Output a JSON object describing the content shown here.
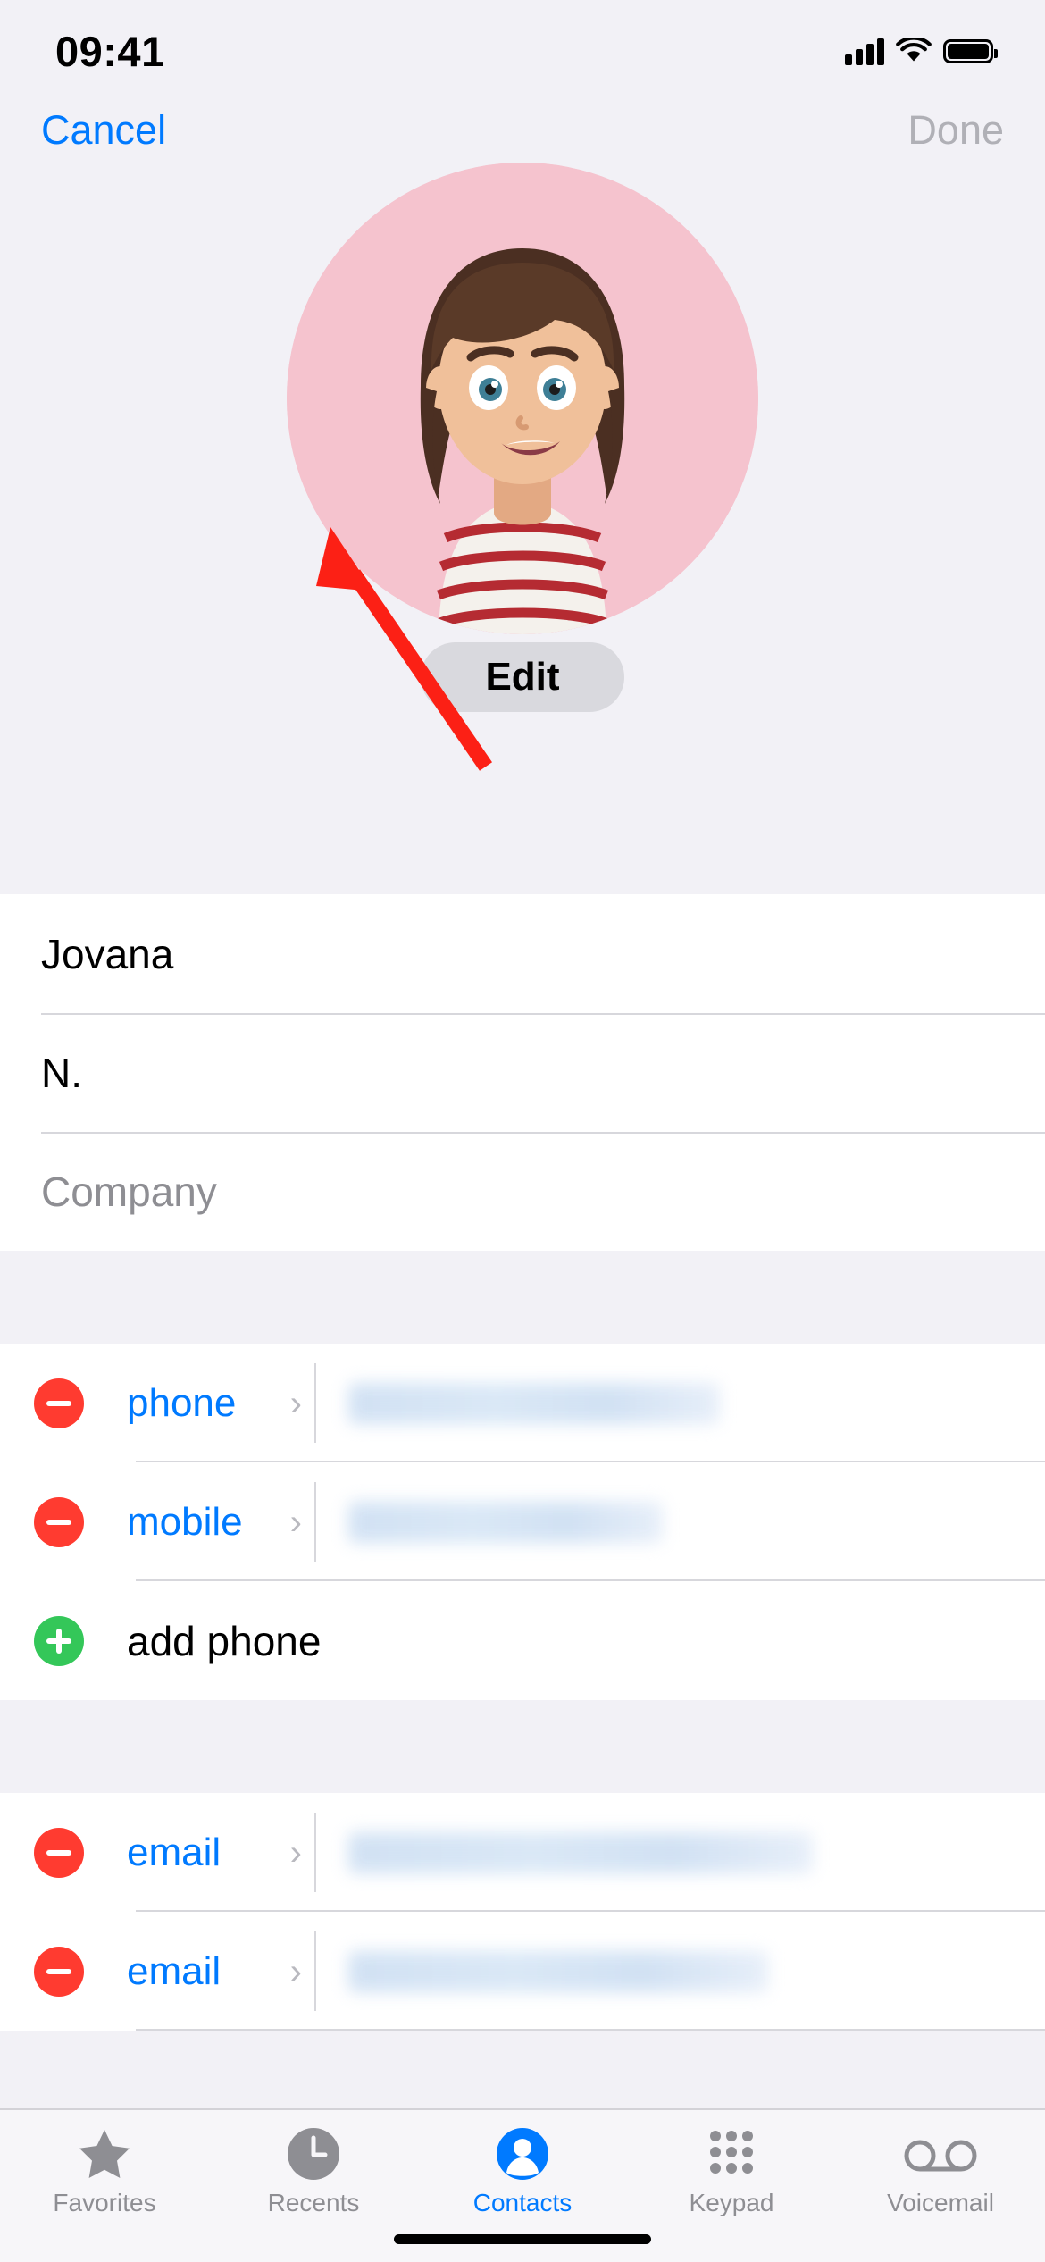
{
  "status_bar": {
    "time": "09:41",
    "cellular_icon": "signal-bars-icon",
    "wifi_icon": "wifi-icon",
    "battery_icon": "battery-icon"
  },
  "nav": {
    "cancel_label": "Cancel",
    "done_label": "Done"
  },
  "avatar": {
    "edit_label": "Edit",
    "background_color": "#f5c3ce"
  },
  "name_fields": [
    {
      "name": "first-name-field",
      "value": "Jovana",
      "placeholder": "First name",
      "is_placeholder": false
    },
    {
      "name": "last-name-field",
      "value": "N.",
      "placeholder": "Last name",
      "is_placeholder": false
    },
    {
      "name": "company-field",
      "value": "Company",
      "placeholder": "Company",
      "is_placeholder": true
    }
  ],
  "phone_section": {
    "entries": [
      {
        "label": "phone",
        "value": "",
        "delete_icon": "minus-circle-icon",
        "disclosure_icon": "chevron-right-icon"
      },
      {
        "label": "mobile",
        "value": "",
        "delete_icon": "minus-circle-icon",
        "disclosure_icon": "chevron-right-icon"
      }
    ],
    "add_label": "add phone",
    "add_icon": "plus-circle-icon"
  },
  "email_section": {
    "entries": [
      {
        "label": "email",
        "value": "",
        "delete_icon": "minus-circle-icon",
        "disclosure_icon": "chevron-right-icon"
      },
      {
        "label": "email",
        "value": "",
        "delete_icon": "minus-circle-icon",
        "disclosure_icon": "chevron-right-icon"
      }
    ]
  },
  "annotation": {
    "arrow_color": "#fc2015",
    "points_to": "Edit"
  },
  "tab_bar": {
    "items": [
      {
        "label": "Favorites",
        "icon": "star-icon",
        "active": false
      },
      {
        "label": "Recents",
        "icon": "clock-icon",
        "active": false
      },
      {
        "label": "Contacts",
        "icon": "person-circle-icon",
        "active": true
      },
      {
        "label": "Keypad",
        "icon": "keypad-icon",
        "active": false
      },
      {
        "label": "Voicemail",
        "icon": "voicemail-icon",
        "active": false
      }
    ],
    "active_color": "#007aff",
    "inactive_color": "#8e8e93"
  }
}
